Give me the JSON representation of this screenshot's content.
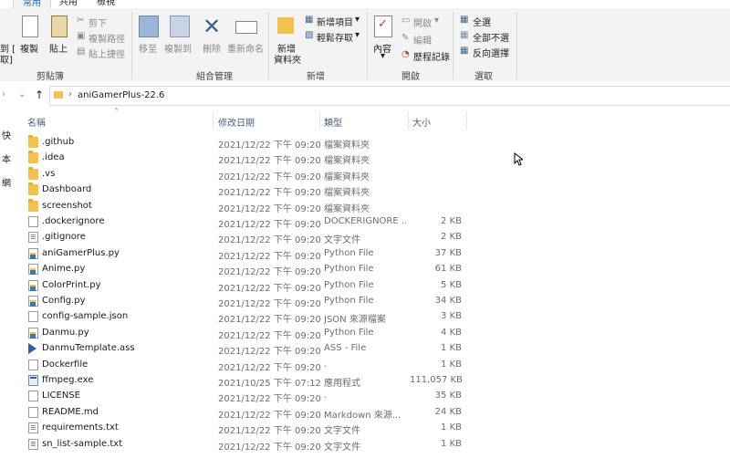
{
  "tabs": {
    "home": "常用",
    "share": "共用",
    "view": "檢視"
  },
  "ribbon": {
    "clipboard": {
      "pin_partial": "到 [",
      "pin_partial2": "取]",
      "copy": "複製",
      "paste": "貼上",
      "cut": "剪下",
      "copy_path": "複製路徑",
      "paste_shortcut": "貼上捷徑",
      "label": "剪貼簿"
    },
    "organize": {
      "move_to": "移至",
      "copy_to": "複製到",
      "delete": "刪除",
      "rename": "重新命名",
      "label": "組合管理"
    },
    "new": {
      "new_folder_1": "新增",
      "new_folder_2": "資料夾",
      "new_item": "新增項目",
      "easy_access": "輕鬆存取",
      "label": "新增"
    },
    "open": {
      "properties": "內容",
      "open": "開啟",
      "edit": "編輯",
      "history": "歷程記錄",
      "label": "開啟"
    },
    "select": {
      "select_all": "全選",
      "select_none": "全部不選",
      "invert": "反向選擇",
      "label": "選取"
    }
  },
  "address": {
    "path": "aniGamerPlus-22.6"
  },
  "nav_pane": {
    "items": [
      "快",
      "本",
      "網"
    ]
  },
  "columns": {
    "name": "名稱",
    "date": "修改日期",
    "type": "類型",
    "size": "大小"
  },
  "files": [
    {
      "name": ".github",
      "date": "2021/12/22 下午 09:20",
      "type": "檔案資料夾",
      "size": "",
      "icon": "folder"
    },
    {
      "name": ".idea",
      "date": "2021/12/22 下午 09:20",
      "type": "檔案資料夾",
      "size": "",
      "icon": "folder"
    },
    {
      "name": ".vs",
      "date": "2021/12/22 下午 09:20",
      "type": "檔案資料夾",
      "size": "",
      "icon": "folder"
    },
    {
      "name": "Dashboard",
      "date": "2021/12/22 下午 09:20",
      "type": "檔案資料夾",
      "size": "",
      "icon": "folder"
    },
    {
      "name": "screenshot",
      "date": "2021/12/22 下午 09:20",
      "type": "檔案資料夾",
      "size": "",
      "icon": "folder"
    },
    {
      "name": ".dockerignore",
      "date": "2021/12/22 下午 09:20",
      "type": "DOCKERIGNORE ...",
      "size": "2 KB",
      "icon": "doc"
    },
    {
      "name": ".gitignore",
      "date": "2021/12/22 下午 09:20",
      "type": "文字文件",
      "size": "2 KB",
      "icon": "txt"
    },
    {
      "name": "aniGamerPlus.py",
      "date": "2021/12/22 下午 09:20",
      "type": "Python File",
      "size": "37 KB",
      "icon": "py"
    },
    {
      "name": "Anime.py",
      "date": "2021/12/22 下午 09:20",
      "type": "Python File",
      "size": "61 KB",
      "icon": "py"
    },
    {
      "name": "ColorPrint.py",
      "date": "2021/12/22 下午 09:20",
      "type": "Python File",
      "size": "5 KB",
      "icon": "py"
    },
    {
      "name": "Config.py",
      "date": "2021/12/22 下午 09:20",
      "type": "Python File",
      "size": "34 KB",
      "icon": "py"
    },
    {
      "name": "config-sample.json",
      "date": "2021/12/22 下午 09:20",
      "type": "JSON 來源檔案",
      "size": "3 KB",
      "icon": "doc"
    },
    {
      "name": "Danmu.py",
      "date": "2021/12/22 下午 09:20",
      "type": "Python File",
      "size": "4 KB",
      "icon": "py"
    },
    {
      "name": "DanmuTemplate.ass",
      "date": "2021/12/22 下午 09:20",
      "type": "ASS - File",
      "size": "1 KB",
      "icon": "ass"
    },
    {
      "name": "Dockerfile",
      "date": "2021/12/22 下午 09:20",
      "type": ".",
      "size": "1 KB",
      "icon": "doc"
    },
    {
      "name": "ffmpeg.exe",
      "date": "2021/10/25 下午 07:12",
      "type": "應用程式",
      "size": "111,057 KB",
      "icon": "exe"
    },
    {
      "name": "LICENSE",
      "date": "2021/12/22 下午 09:20",
      "type": ".",
      "size": "35 KB",
      "icon": "doc"
    },
    {
      "name": "README.md",
      "date": "2021/12/22 下午 09:20",
      "type": "Markdown 來源...",
      "size": "24 KB",
      "icon": "doc"
    },
    {
      "name": "requirements.txt",
      "date": "2021/12/22 下午 09:20",
      "type": "文字文件",
      "size": "1 KB",
      "icon": "txt"
    },
    {
      "name": "sn_list-sample.txt",
      "date": "2021/12/22 下午 09:20",
      "type": "文字文件",
      "size": "1 KB",
      "icon": "txt"
    }
  ]
}
